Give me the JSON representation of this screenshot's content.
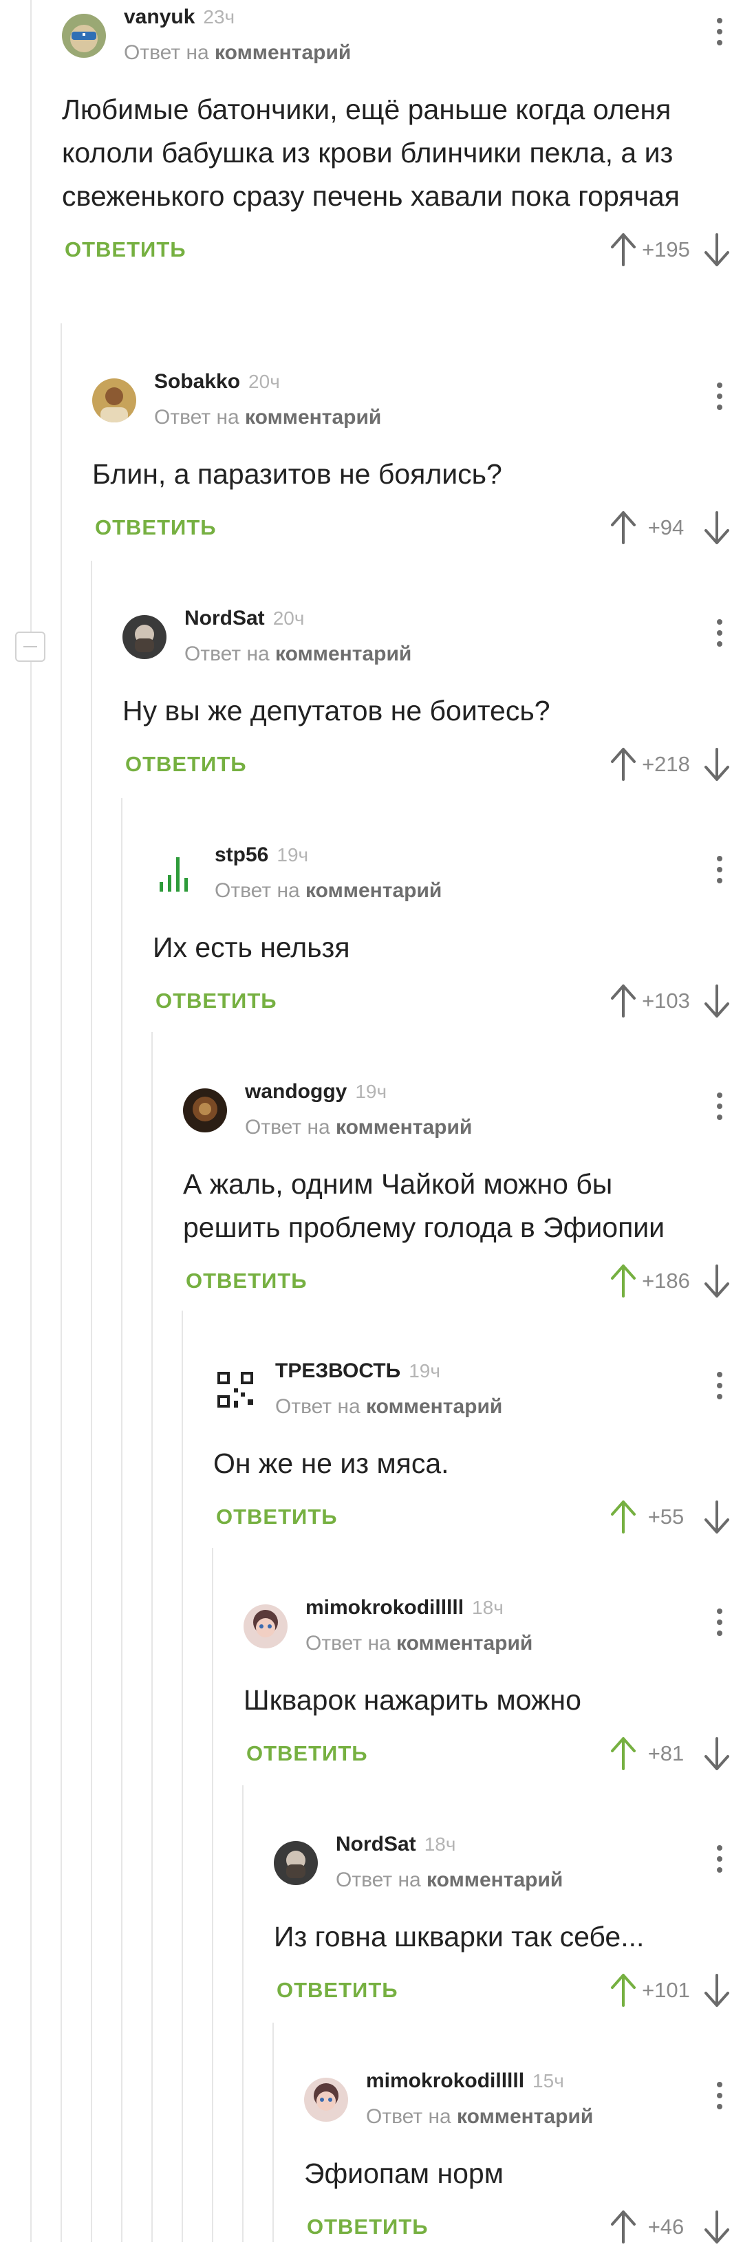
{
  "reply_label": "ОТВЕТИТЬ",
  "reply_to_prefix": "Ответ на",
  "reply_to_link": "комментарий",
  "colors": {
    "accent": "#76b041",
    "text": "#222222",
    "muted": "#9a9a9a"
  },
  "comments": [
    {
      "author": "vanyuk",
      "time": "23ч",
      "avatar": "sunglasses-avatar",
      "text": "Любимые батончики, ещё раньше когда оленя кололи бабушка из крови блинчики пекла, а из свеженького сразу печень хавали пока горячая",
      "score": "+195",
      "upvoted": false
    },
    {
      "author": "Sobakko",
      "time": "20ч",
      "avatar": "person-avatar",
      "text": "Блин, а паразитов не боялись?",
      "score": "+94",
      "upvoted": false
    },
    {
      "author": "NordSat",
      "time": "20ч",
      "avatar": "bearded-avatar",
      "text": "Ну вы же депутатов не боитесь?",
      "score": "+218",
      "upvoted": false
    },
    {
      "author": "stp56",
      "time": "19ч",
      "avatar": "signal-bars-avatar",
      "text": "Их есть нельзя",
      "score": "+103",
      "upvoted": false
    },
    {
      "author": "wandoggy",
      "time": "19ч",
      "avatar": "dark-avatar",
      "text": "А жаль, одним Чайкой можно бы решить проблему голода в Эфиопии",
      "score": "+186",
      "upvoted": true
    },
    {
      "author": "ТРЕЗВОСТЬ",
      "time": "19ч",
      "avatar": "qr-code-avatar",
      "text": "Он же не из мяса.",
      "score": "+55",
      "upvoted": true
    },
    {
      "author": "mimokrokodilllll",
      "time": "18ч",
      "avatar": "girl-avatar",
      "text": "Шкварок нажарить можно",
      "score": "+81",
      "upvoted": true
    },
    {
      "author": "NordSat",
      "time": "18ч",
      "avatar": "bearded-avatar",
      "text": "Из говна шкварки так себе...",
      "score": "+101",
      "upvoted": true
    },
    {
      "author": "mimokrokodilllll",
      "time": "15ч",
      "avatar": "girl-avatar",
      "text": "Эфиопам норм",
      "score": "+46",
      "upvoted": false
    }
  ]
}
